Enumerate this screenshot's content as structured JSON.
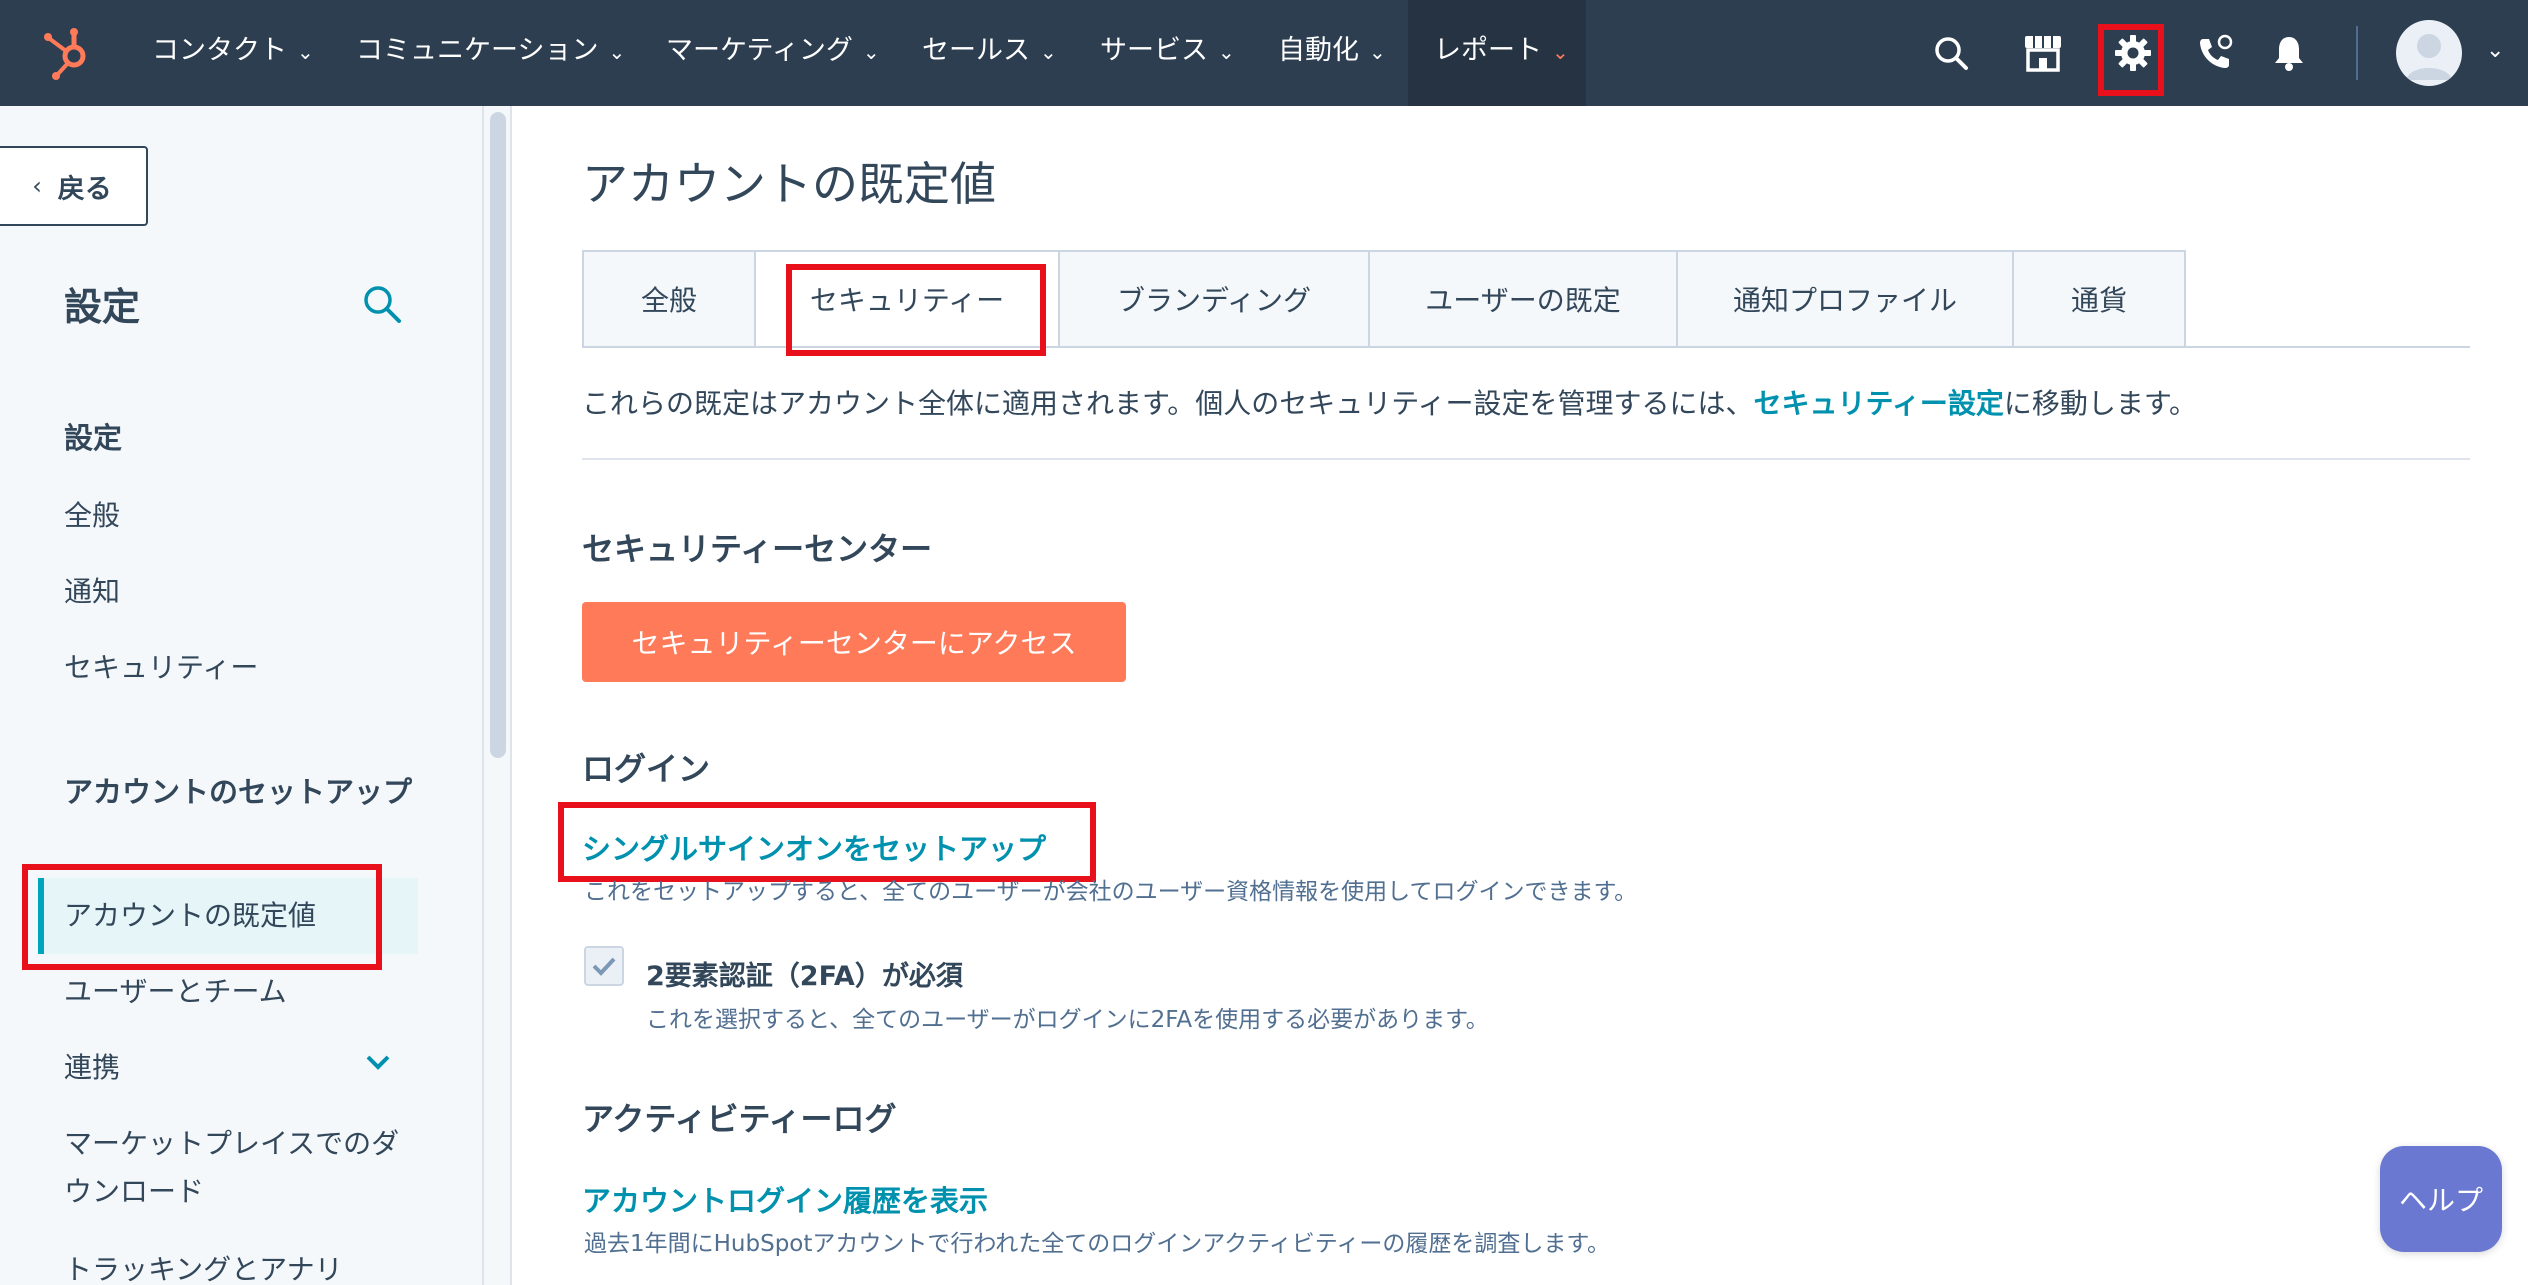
{
  "nav": {
    "items": [
      {
        "label": "コンタクト"
      },
      {
        "label": "コミュニケーション"
      },
      {
        "label": "マーケティング"
      },
      {
        "label": "セールス"
      },
      {
        "label": "サービス"
      },
      {
        "label": "自動化"
      },
      {
        "label": "レポート"
      }
    ],
    "icons": [
      "search-icon",
      "marketplace-icon",
      "settings-gear-icon",
      "calling-icon",
      "notifications-bell-icon"
    ],
    "accent_color": "#ff7a59",
    "bar_color": "#2d3e50"
  },
  "sidebar": {
    "back_label": "戻る",
    "title": "設定",
    "section1": "設定",
    "items1": [
      {
        "label": "全般"
      },
      {
        "label": "通知"
      },
      {
        "label": "セキュリティー"
      }
    ],
    "section2": "アカウントのセットアップ",
    "items2": [
      {
        "label": "アカウントの既定値",
        "selected": true
      },
      {
        "label": "ユーザーとチーム"
      },
      {
        "label": "連携"
      },
      {
        "label": "マーケットプレイスでのダウンロード"
      },
      {
        "label": "トラッキングとアナリ"
      }
    ]
  },
  "main": {
    "title": "アカウントの既定値",
    "tabs": [
      {
        "label": "全般"
      },
      {
        "label": "セキュリティー",
        "active": true
      },
      {
        "label": "ブランディング"
      },
      {
        "label": "ユーザーの既定"
      },
      {
        "label": "通知プロファイル"
      },
      {
        "label": "通貨"
      }
    ],
    "desc_prefix": "これらの既定はアカウント全体に適用されます。個人のセキュリティー設定を管理するには、",
    "desc_link": "セキュリティー設定",
    "desc_suffix": "に移動します。",
    "security_center": {
      "heading": "セキュリティーセンター",
      "button": "セキュリティーセンターにアクセス"
    },
    "login": {
      "heading": "ログイン",
      "sso_link": "シングルサインオンをセットアップ",
      "sso_help": "これをセットアップすると、全てのユーザーが会社のユーザー資格情報を使用してログインできます。",
      "twofa_label": "2要素認証（2FA）が必須",
      "twofa_checked": true,
      "twofa_help": "これを選択すると、全てのユーザーがログインに2FAを使用する必要があります。"
    },
    "activity": {
      "heading": "アクティビティーログ",
      "link": "アカウントログイン履歴を表示",
      "help": "過去1年間にHubSpotアカウントで行われた全てのログインアクティビティーの履歴を調査します。"
    }
  },
  "help_button": "ヘルプ"
}
